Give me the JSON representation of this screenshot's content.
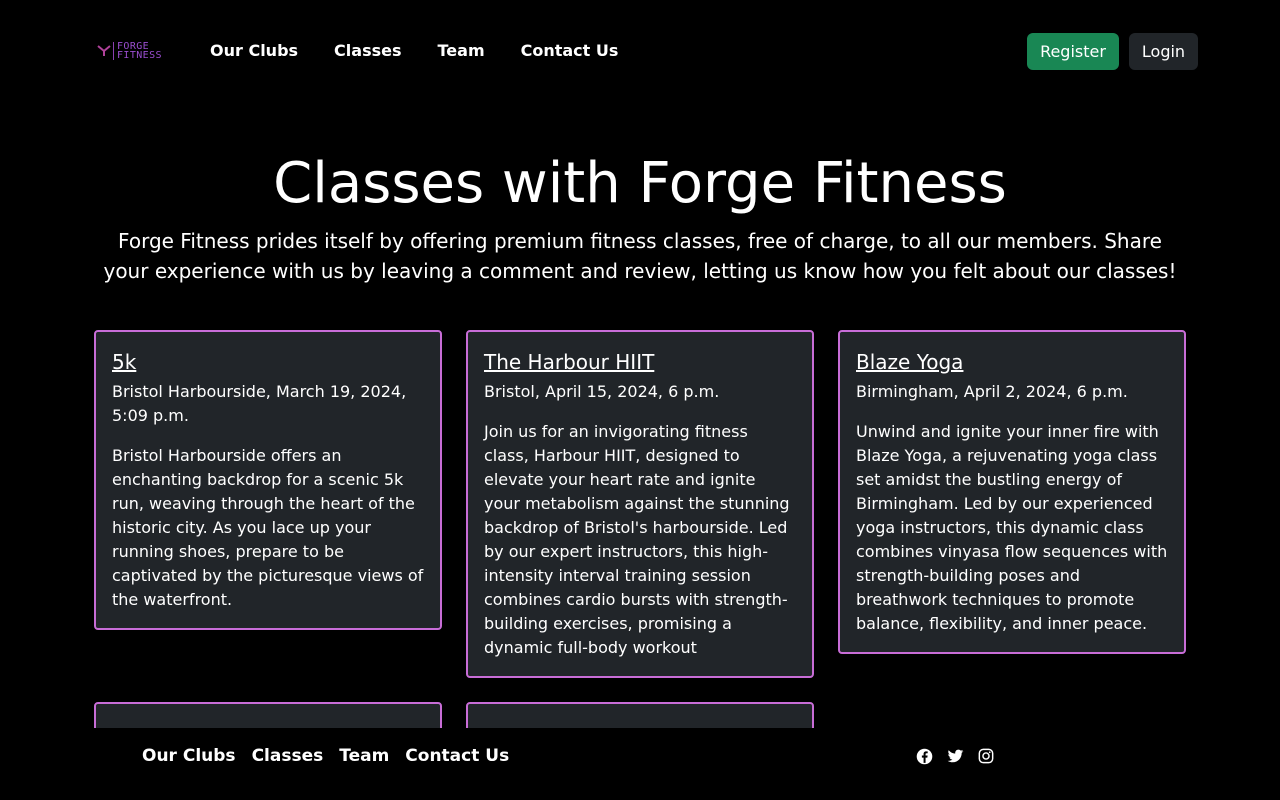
{
  "brand": {
    "logo_line1": "FORGE",
    "logo_line2": "FITNESS",
    "accent_color": "#9a4ed0"
  },
  "nav": {
    "links": [
      "Our Clubs",
      "Classes",
      "Team",
      "Contact Us"
    ],
    "register_label": "Register",
    "login_label": "Login"
  },
  "hero": {
    "title": "Classes with Forge Fitness",
    "description": "Forge Fitness prides itself by offering premium fitness classes, free of charge, to all our members. Share your experience with us by leaving a comment and review, letting us know how you felt about our classes!"
  },
  "classes": [
    {
      "title": "5k",
      "meta": "Bristol Harbourside, March 19, 2024, 5:09 p.m.",
      "description": "Bristol Harbourside offers an enchanting backdrop for a scenic 5k run, weaving through the heart of the historic city. As you lace up your running shoes, prepare to be captivated by the picturesque views of the waterfront."
    },
    {
      "title": "The Harbour HIIT",
      "meta": "Bristol, April 15, 2024, 6 p.m.",
      "description": "Join us for an invigorating fitness class, Harbour HIIT, designed to elevate your heart rate and ignite your metabolism against the stunning backdrop of Bristol's harbourside. Led by our expert instructors, this high-intensity interval training session combines cardio bursts with strength-building exercises, promising a dynamic full-body workout"
    },
    {
      "title": "Blaze Yoga",
      "meta": "Birmingham, April 2, 2024, 6 p.m.",
      "description": "Unwind and ignite your inner fire with Blaze Yoga, a rejuvenating yoga class set amidst the bustling energy of Birmingham. Led by our experienced yoga instructors, this dynamic class combines vinyasa flow sequences with strength-building poses and breathwork techniques to promote balance, flexibility, and inner peace."
    }
  ],
  "footer": {
    "links": [
      "Our Clubs",
      "Classes",
      "Team",
      "Contact Us"
    ],
    "socials": [
      "facebook-icon",
      "twitter-icon",
      "instagram-icon"
    ]
  },
  "colors": {
    "card_border": "#c86dd7",
    "card_bg": "#212529",
    "register_bg": "#198754",
    "login_bg": "#212529"
  }
}
